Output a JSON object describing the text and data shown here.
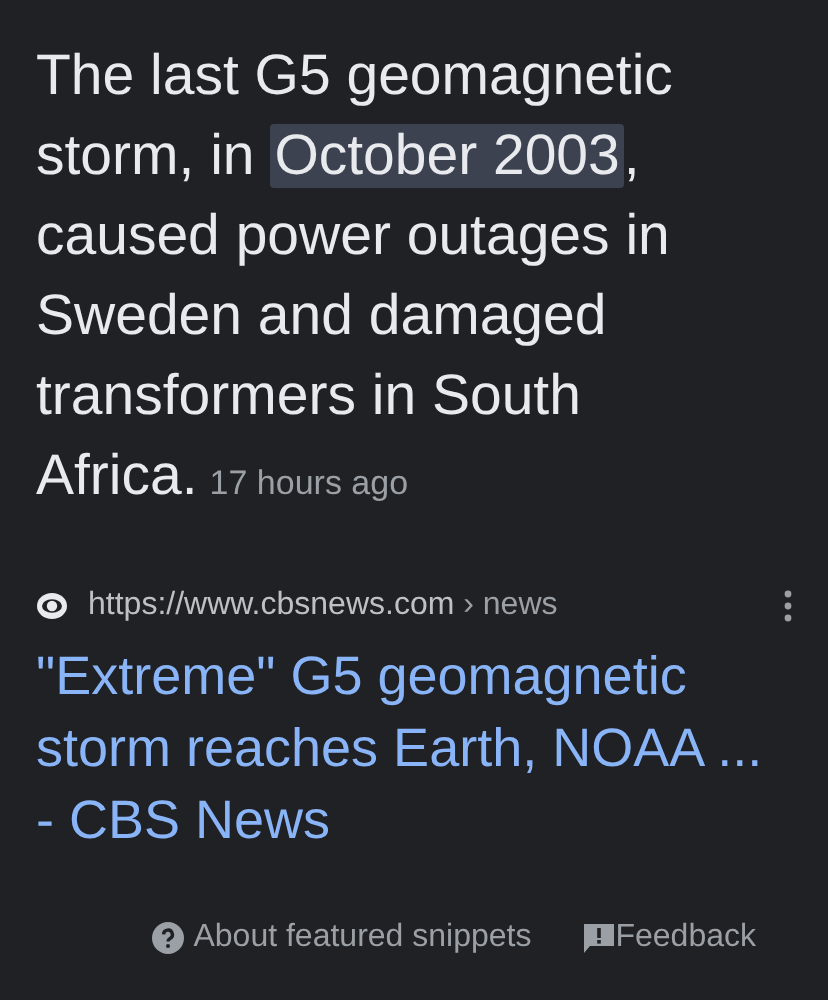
{
  "snippet": {
    "before": "The last G5 geomagnetic storm, in ",
    "highlight": "October 2003",
    "after": ", caused power outages in Sweden and damaged transformers in South Africa.",
    "time": "17 hours ago"
  },
  "source": {
    "url": "https://www.cbsnews.com",
    "path": "› news"
  },
  "result_title": "\"Extreme\" G5 geomagnetic storm reaches Earth, NOAA ... - CBS News",
  "footer": {
    "about": "About featured snippets",
    "feedback": "Feedback"
  }
}
